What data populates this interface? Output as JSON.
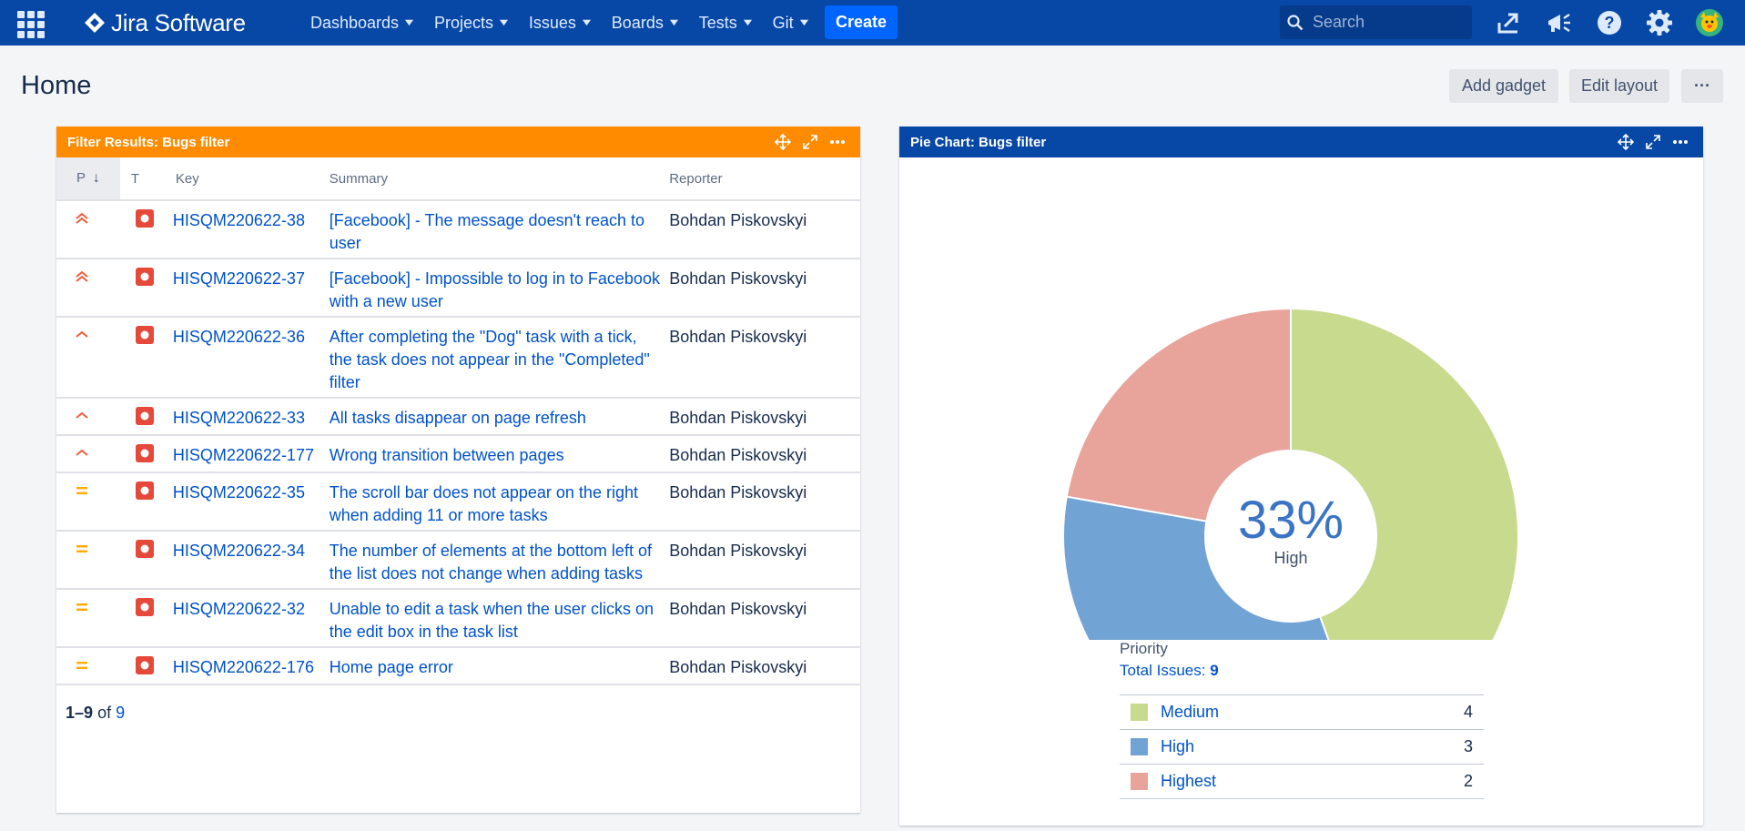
{
  "nav": {
    "product": "Jira Software",
    "items": [
      {
        "label": "Dashboards"
      },
      {
        "label": "Projects"
      },
      {
        "label": "Issues"
      },
      {
        "label": "Boards"
      },
      {
        "label": "Tests"
      },
      {
        "label": "Git"
      }
    ],
    "create_label": "Create",
    "search_placeholder": "Search"
  },
  "page": {
    "title": "Home",
    "add_gadget_label": "Add gadget",
    "edit_layout_label": "Edit layout",
    "more_label": "···"
  },
  "filter_gadget": {
    "title": "Filter Results: Bugs filter",
    "header_color": "#ff8b00",
    "columns": {
      "p": "P",
      "t": "T",
      "key": "Key",
      "summary": "Summary",
      "reporter": "Reporter"
    },
    "rows": [
      {
        "priority": "highest",
        "key": "HISQM220622-38",
        "summary": "[Facebook] - The message doesn't reach to user",
        "reporter": "Bohdan Piskovskyi"
      },
      {
        "priority": "highest",
        "key": "HISQM220622-37",
        "summary": "[Facebook] - Impossible to log in to Facebook with a new user",
        "reporter": "Bohdan Piskovskyi"
      },
      {
        "priority": "high",
        "key": "HISQM220622-36",
        "summary": "After completing the \"Dog\" task with a tick, the task does not appear in the \"Completed\" filter",
        "reporter": "Bohdan Piskovskyi"
      },
      {
        "priority": "high",
        "key": "HISQM220622-33",
        "summary": "All tasks disappear on page refresh",
        "reporter": "Bohdan Piskovskyi"
      },
      {
        "priority": "high",
        "key": "HISQM220622-177",
        "summary": "Wrong transition between pages",
        "reporter": "Bohdan Piskovskyi"
      },
      {
        "priority": "medium",
        "key": "HISQM220622-35",
        "summary": "The scroll bar does not appear on the right when adding 11 or more tasks",
        "reporter": "Bohdan Piskovskyi"
      },
      {
        "priority": "medium",
        "key": "HISQM220622-34",
        "summary": "The number of elements at the bottom left of the list does not change when adding tasks",
        "reporter": "Bohdan Piskovskyi"
      },
      {
        "priority": "medium",
        "key": "HISQM220622-32",
        "summary": "Unable to edit a task when the user clicks on the edit box in the task list",
        "reporter": "Bohdan Piskovskyi"
      },
      {
        "priority": "medium",
        "key": "HISQM220622-176",
        "summary": "Home page error",
        "reporter": "Bohdan Piskovskyi"
      }
    ],
    "pager": {
      "range": "1–9",
      "of": "of",
      "total": "9"
    }
  },
  "pie_gadget": {
    "title": "Pie Chart: Bugs filter",
    "header_color": "#0747a6",
    "center_percent": "33%",
    "center_label": "High",
    "legend_title": "Priority",
    "total_label": "Total Issues:",
    "total_value": "9"
  },
  "chart_data": {
    "type": "pie",
    "title": "Pie Chart: Bugs filter",
    "categories": [
      "Medium",
      "High",
      "Highest"
    ],
    "values": [
      4,
      3,
      2
    ],
    "colors": [
      "#c7da8e",
      "#72a3d5",
      "#e8a39b"
    ]
  },
  "colors": {
    "nav_bg": "#0747a6",
    "create_btn": "#0065ff",
    "bug_icon": "#e5493a",
    "priority_high": "#f15c3c",
    "priority_medium": "#ffab00"
  }
}
